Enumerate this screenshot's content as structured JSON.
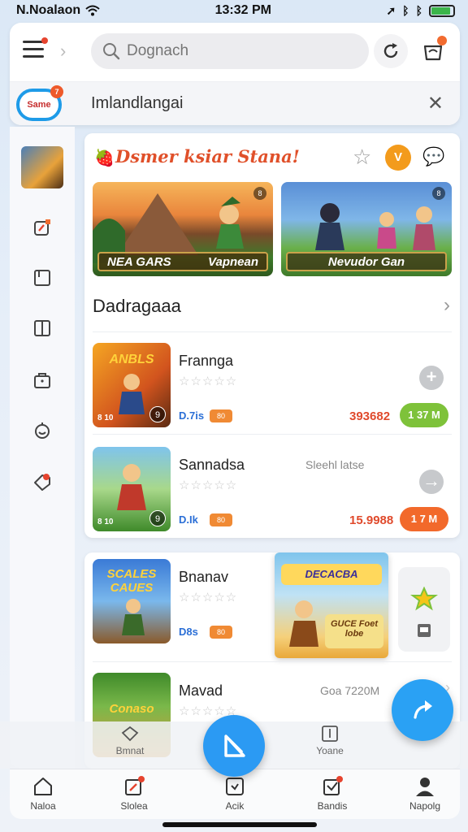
{
  "status": {
    "carrier": "N.Noalaon",
    "time": "13:32 PM"
  },
  "header": {
    "search_placeholder": "Dognach",
    "banner_text": "Imlandlangai",
    "logo_text": "Same",
    "logo_badge": "7"
  },
  "featured": {
    "title": "Dsmer ksiar Stana!",
    "check_label": "V",
    "tiles": [
      {
        "label": "NEA GARS",
        "sub": "Vapnean",
        "corner": "8"
      },
      {
        "label": "Nevudor Gan",
        "corner": "8"
      }
    ]
  },
  "section": {
    "title": "Dadragaaa"
  },
  "apps": [
    {
      "name": "Frannga",
      "stars": "☆☆☆☆☆",
      "size": "D.7is",
      "tag": "80",
      "side_text": "",
      "price": "393682",
      "get": "1 37 M",
      "get_color": "#7ec23a",
      "thumb_tag": "8 10",
      "thumb_ctrl": "9"
    },
    {
      "name": "Sannadsa",
      "stars": "☆☆☆☆☆",
      "size": "D.Ik",
      "tag": "80",
      "side_text": "Sleehl latse",
      "price": "15.9988",
      "get": "1 7 M",
      "get_color": "#f2692b",
      "thumb_tag": "8 10",
      "thumb_ctrl": "9"
    },
    {
      "name": "Bnanav",
      "stars": "☆☆☆☆☆",
      "size": "D8s",
      "tag": "80",
      "side_text": "",
      "price": "",
      "get": "",
      "get_color": "",
      "thumb_tag": "",
      "thumb_ctrl": ""
    },
    {
      "name": "Mavad",
      "stars": "☆☆☆☆☆",
      "size": "",
      "tag": "",
      "side_text": "Goa 7220M",
      "price": "",
      "get": "",
      "get_color": "",
      "thumb_tag": "",
      "thumb_ctrl": ""
    }
  ],
  "thumbs_text": {
    "app1": "ANBLS",
    "app3": "SCALES CAUES",
    "app4": "Conaso"
  },
  "promo": {
    "title": "DECACBA",
    "sub": "GUCE Foet lobe"
  },
  "ghost_strip": {
    "left_label": "Bmnat",
    "right_label": "Yoane"
  },
  "nav": {
    "items": [
      {
        "label": "Naloa"
      },
      {
        "label": "Slolea"
      },
      {
        "label": "Acik"
      },
      {
        "label": "Bandis"
      },
      {
        "label": "Napolg"
      }
    ]
  },
  "colors": {
    "accent": "#2b9af3",
    "orange": "#f2692b",
    "green": "#7ec23a",
    "badge": "#e6442f"
  }
}
